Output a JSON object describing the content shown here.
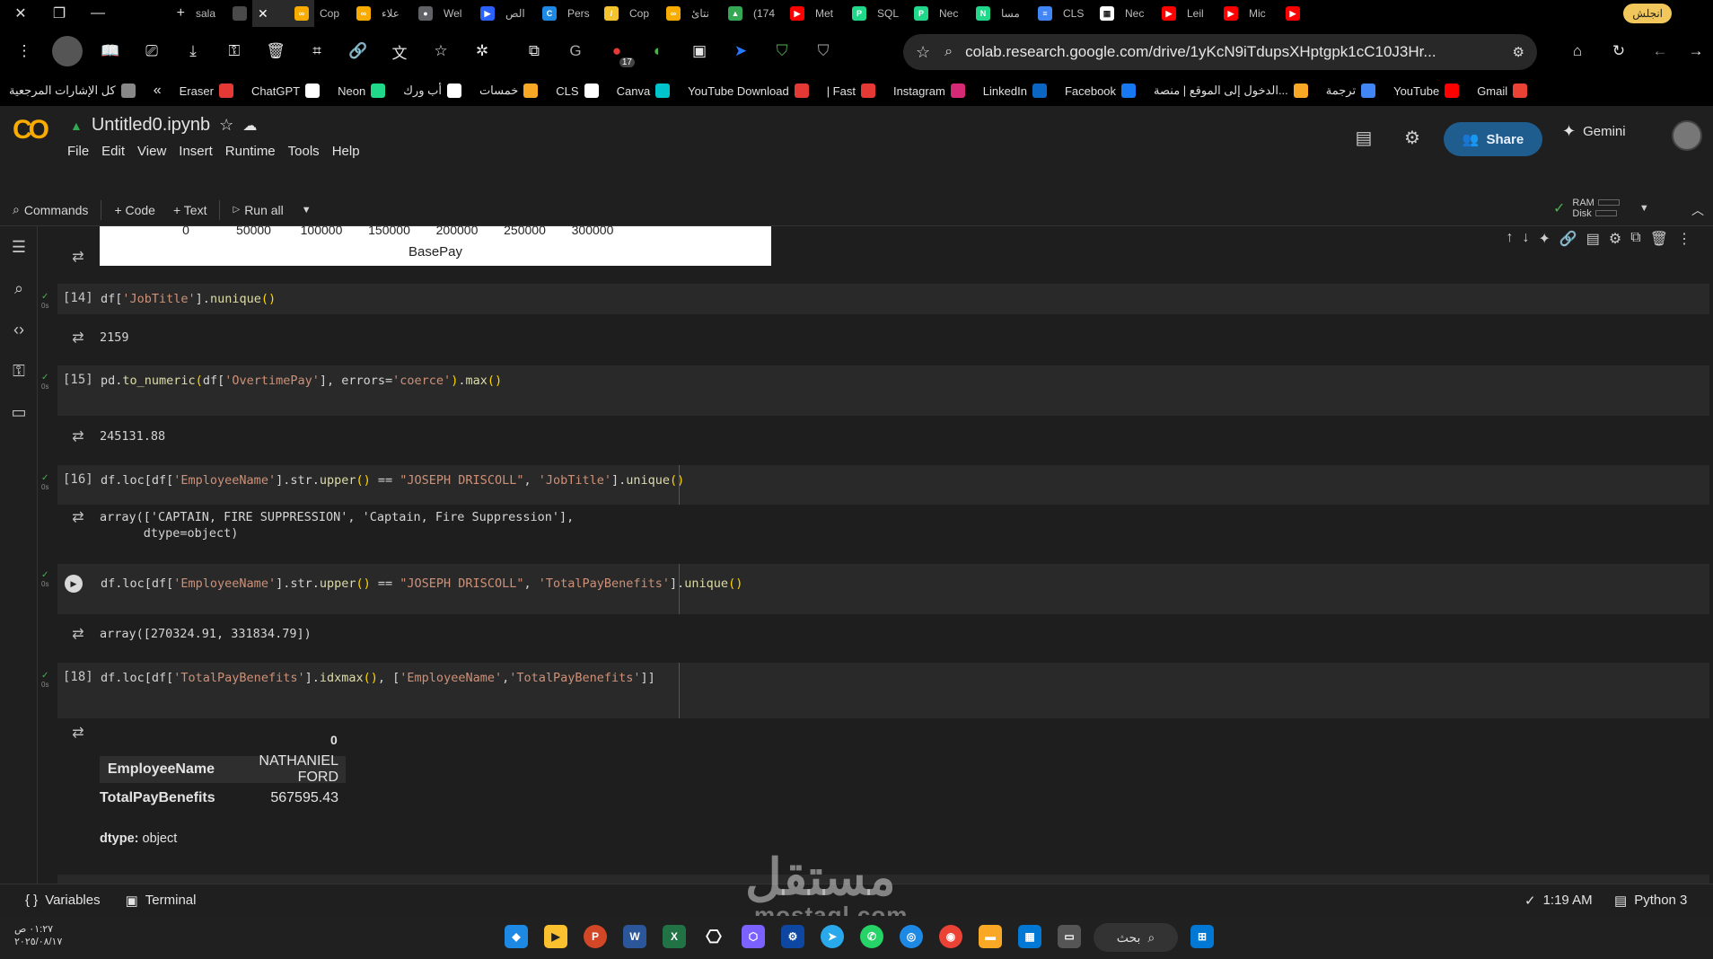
{
  "tabs": [
    {
      "title": "sala",
      "color": "#4a4a4a",
      "glyph": ""
    },
    {
      "title": "",
      "color": "#f9ab00",
      "glyph": "∞",
      "active": true
    },
    {
      "title": "Cop",
      "color": "#f9ab00",
      "glyph": "∞"
    },
    {
      "title": "علاء",
      "color": "#5f6368",
      "glyph": "●"
    },
    {
      "title": "Wel",
      "color": "#2962ff",
      "glyph": "▶"
    },
    {
      "title": "الص",
      "color": "#1e88e5",
      "glyph": "C"
    },
    {
      "title": "Pers",
      "color": "#f4c430",
      "glyph": "/"
    },
    {
      "title": "Cop",
      "color": "#f9ab00",
      "glyph": "∞"
    },
    {
      "title": "نتائ",
      "color": "#34a853",
      "glyph": "▲"
    },
    {
      "title": "(174",
      "color": "#ff0000",
      "glyph": "▶"
    },
    {
      "title": "Met",
      "color": "#21d789",
      "glyph": "P"
    },
    {
      "title": "SQL",
      "color": "#21d789",
      "glyph": "P"
    },
    {
      "title": "Nec",
      "color": "#21d789",
      "glyph": "N"
    },
    {
      "title": "مسا",
      "color": "#4285f4",
      "glyph": "≡"
    },
    {
      "title": "CLS",
      "color": "#ffffff",
      "glyph": "▦"
    },
    {
      "title": "Nec",
      "color": "#ff0000",
      "glyph": "▶"
    },
    {
      "title": "Leil",
      "color": "#ff0000",
      "glyph": "▶"
    },
    {
      "title": "Mic",
      "color": "#ff0000",
      "glyph": "▶"
    }
  ],
  "profile_label": "انجلش",
  "address_url": "colab.research.google.com/drive/1yKcN9iTdupsXHptgpk1cC10J3Hr...",
  "ext_badge": "17",
  "bookmarks": [
    {
      "label": "كل الإشارات المرجعية",
      "color": "#888"
    },
    {
      "label": "Eraser",
      "color": "#e53935"
    },
    {
      "label": "ChatGPT",
      "color": "#ffffff"
    },
    {
      "label": "Neon",
      "color": "#21d789"
    },
    {
      "label": "أب ورك",
      "color": "#ffffff"
    },
    {
      "label": "خمسات",
      "color": "#f9a825"
    },
    {
      "label": "CLS",
      "color": "#ffffff"
    },
    {
      "label": "Canva",
      "color": "#00c4cc"
    },
    {
      "label": "YouTube Download",
      "color": "#e53935"
    },
    {
      "label": "| Fast",
      "color": "#e53935"
    },
    {
      "label": "Instagram",
      "color": "#d62976"
    },
    {
      "label": "LinkedIn",
      "color": "#0a66c2"
    },
    {
      "label": "Facebook",
      "color": "#1877f2"
    },
    {
      "label": "الدخول إلى الموقع | منصة...",
      "color": "#f9a825"
    },
    {
      "label": "ترجمة",
      "color": "#4285f4"
    },
    {
      "label": "YouTube",
      "color": "#ff0000"
    },
    {
      "label": "Gmail",
      "color": "#ea4335"
    }
  ],
  "notebook": {
    "title": "Untitled0.ipynb",
    "menus": [
      "File",
      "Edit",
      "View",
      "Insert",
      "Runtime",
      "Tools",
      "Help"
    ],
    "share_label": "Share",
    "gemini_label": "Gemini",
    "toolbar": {
      "commands_label": "Commands",
      "code_label": "+ Code",
      "text_label": "+ Text",
      "run_all_label": "Run all",
      "ram_label": "RAM",
      "disk_label": "Disk"
    }
  },
  "plot": {
    "ticks": [
      "0",
      "50000",
      "100000",
      "150000",
      "200000",
      "250000",
      "300000"
    ],
    "xlabel": "BasePay"
  },
  "cells": {
    "c14": {
      "num": "[14]",
      "output": "2159",
      "time": "0s"
    },
    "c15": {
      "num": "[15]",
      "output": "245131.88",
      "time": "0s"
    },
    "c16": {
      "num": "[16]",
      "output_line1": "array(['CAPTAIN, FIRE SUPPRESSION', 'Captain, Fire Suppression'],",
      "output_line2": "      dtype=object)",
      "time": "0s"
    },
    "c17": {
      "output": "array([270324.91, 331834.79])",
      "time": "0s"
    },
    "c18": {
      "num": "[18]",
      "time": "0s",
      "df_header": "0",
      "rows": [
        {
          "key": "EmployeeName",
          "value": "NATHANIEL FORD"
        },
        {
          "key": "TotalPayBenefits",
          "value": "567595.43"
        }
      ],
      "dtype_label": "dtype:",
      "dtype_value": "object"
    }
  },
  "status": {
    "variables_label": "Variables",
    "terminal_label": "Terminal",
    "time": "1:19 AM",
    "kernel": "Python 3"
  },
  "watermark": {
    "main": "مستقل",
    "sub": "mostaql.com"
  },
  "taskbar": {
    "clock_time": "٠١:٢٧ ص",
    "clock_date": "٢٠٢٥/٠٨/١٧",
    "search_label": "بحث"
  }
}
